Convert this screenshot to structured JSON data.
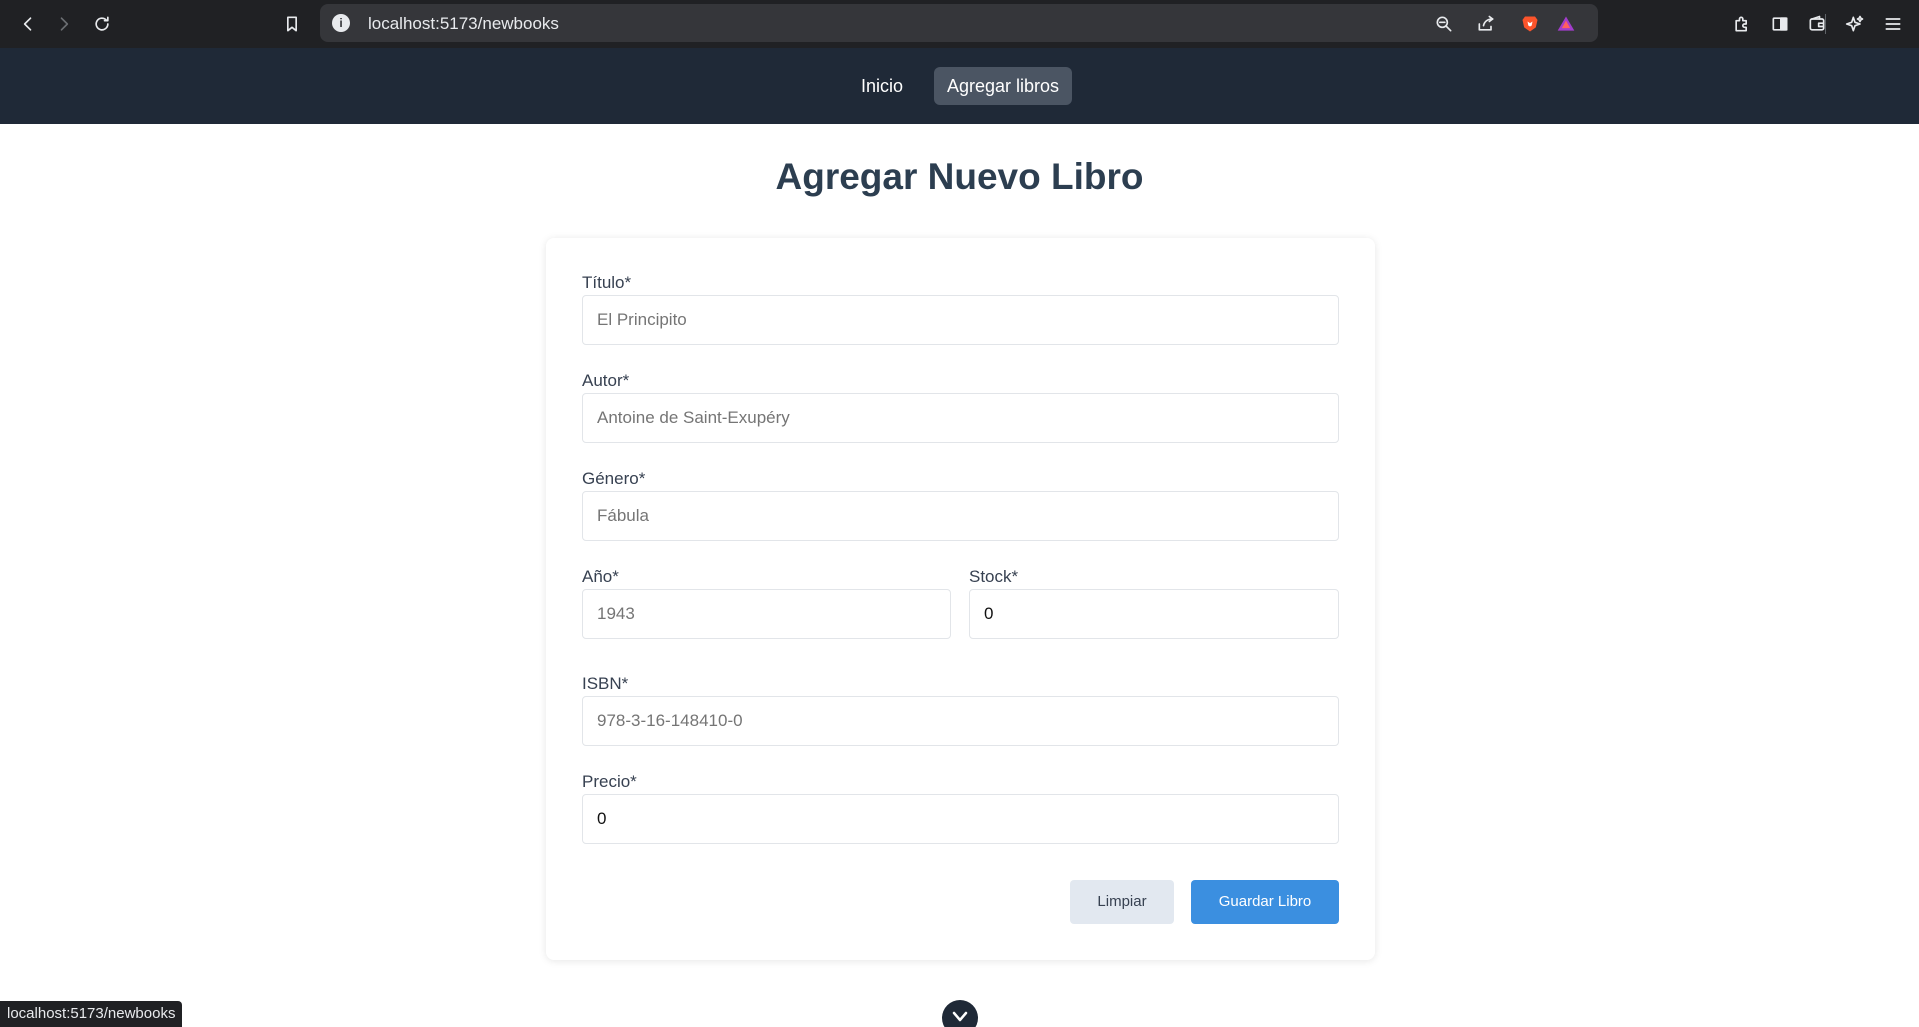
{
  "browser": {
    "url": "localhost:5173/newbooks",
    "status_url": "localhost:5173/newbooks"
  },
  "nav": {
    "items": [
      {
        "label": "Inicio",
        "active": false
      },
      {
        "label": "Agregar libros",
        "active": true
      }
    ]
  },
  "page": {
    "title": "Agregar Nuevo Libro"
  },
  "form": {
    "titulo": {
      "label": "Título*",
      "placeholder": "El Principito"
    },
    "autor": {
      "label": "Autor*",
      "placeholder": "Antoine de Saint-Exupéry"
    },
    "genero": {
      "label": "Género*",
      "placeholder": "Fábula"
    },
    "anio": {
      "label": "Año*",
      "placeholder": "1943"
    },
    "stock": {
      "label": "Stock*",
      "value": "0"
    },
    "isbn": {
      "label": "ISBN*",
      "placeholder": "978-3-16-148410-0"
    },
    "precio": {
      "label": "Precio*",
      "value": "0"
    },
    "clear_label": "Limpiar",
    "save_label": "Guardar Libro"
  },
  "colors": {
    "navbar": "#1f2937",
    "active_nav": "#4b5563",
    "title": "#2c3e50",
    "primary_button": "#3b8fe0",
    "secondary_button": "#e2e8f0"
  }
}
